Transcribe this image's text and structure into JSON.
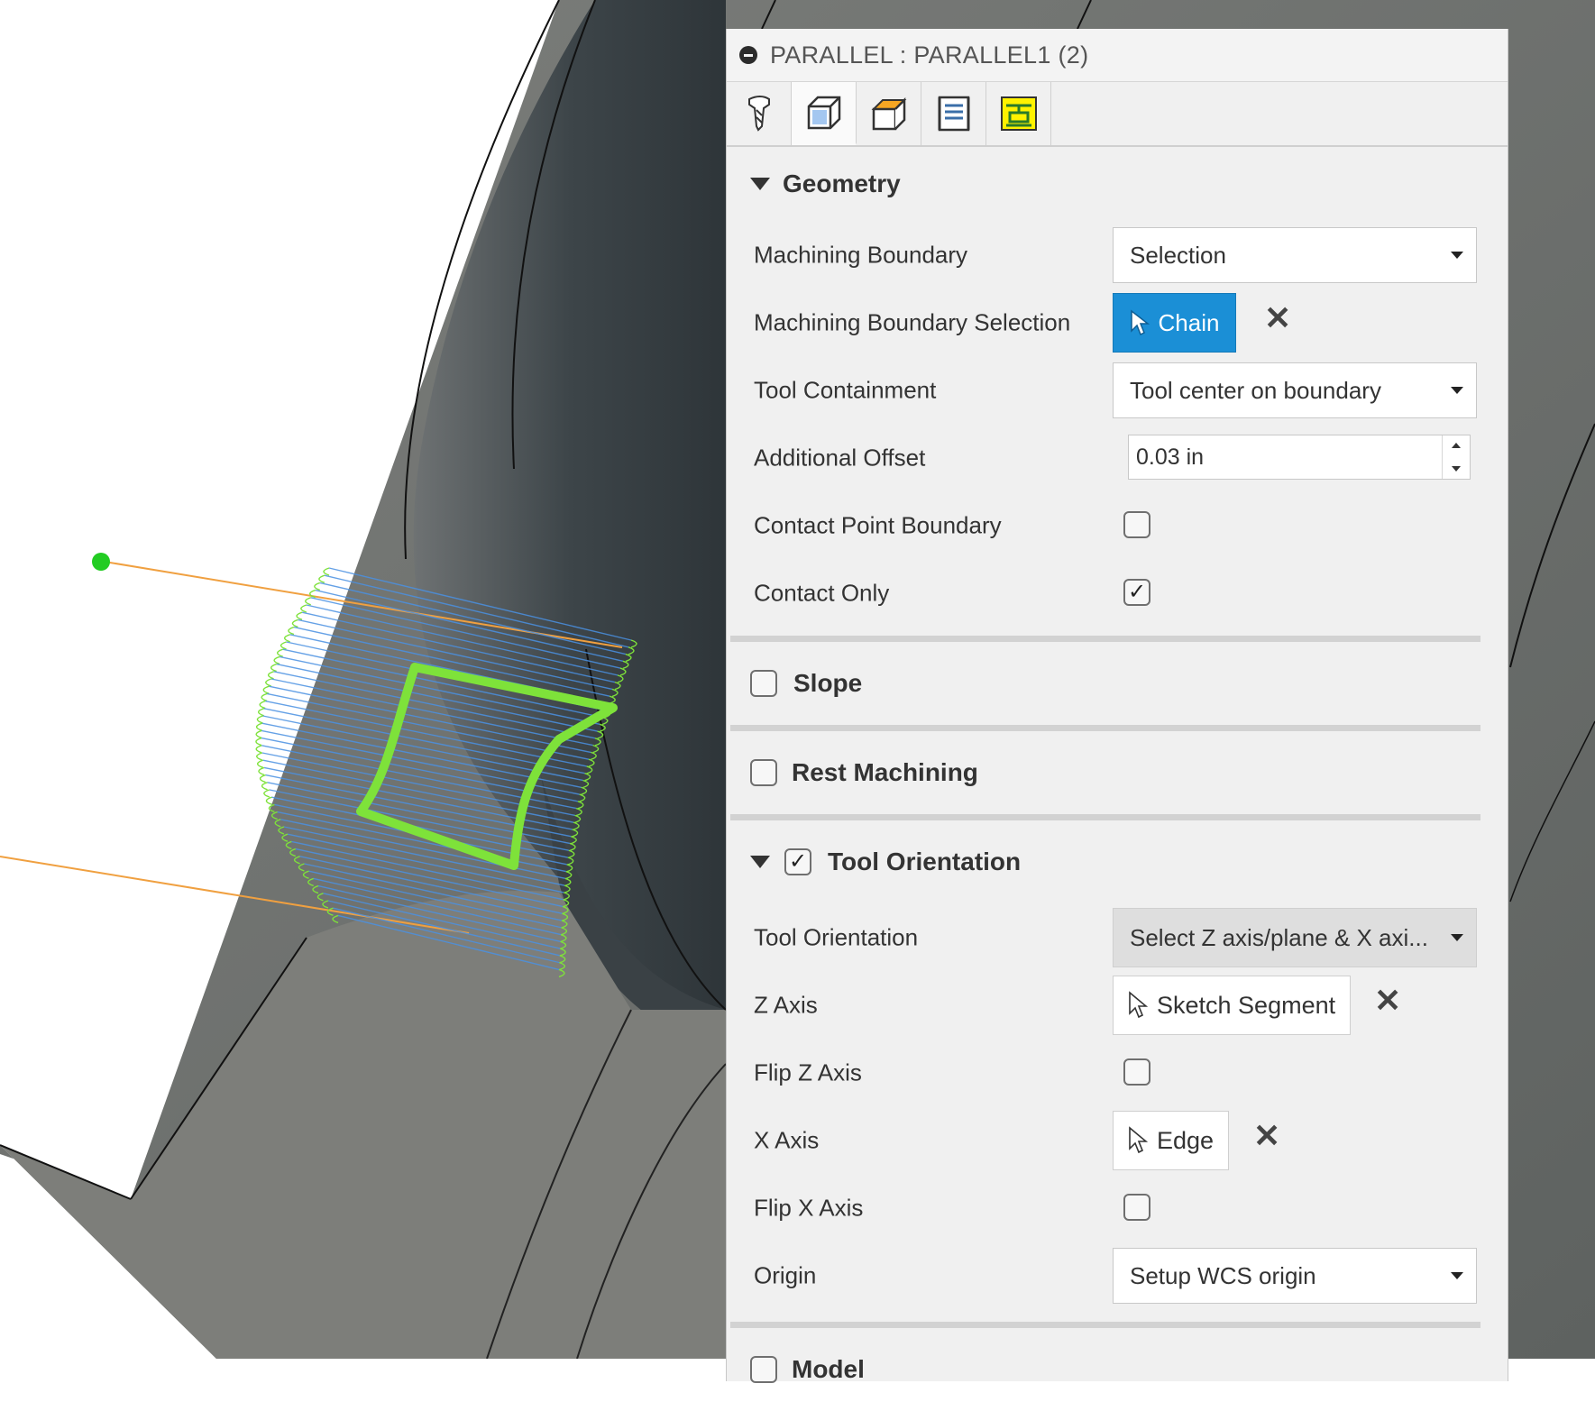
{
  "panel": {
    "title": "PARALLEL : PARALLEL1 (2)",
    "tabs": [
      {
        "name": "tool-tab-icon",
        "active": false
      },
      {
        "name": "geometry-tab-icon",
        "active": true
      },
      {
        "name": "heights-tab-icon",
        "active": false
      },
      {
        "name": "passes-tab-icon",
        "active": false
      },
      {
        "name": "linking-tab-icon",
        "active": false
      }
    ]
  },
  "geometry": {
    "title": "Geometry",
    "machining_boundary": {
      "label": "Machining Boundary",
      "value": "Selection"
    },
    "boundary_selection": {
      "label": "Machining Boundary Selection",
      "button": "Chain",
      "clear": "✕"
    },
    "tool_containment": {
      "label": "Tool Containment",
      "value": "Tool center on boundary"
    },
    "additional_offset": {
      "label": "Additional Offset",
      "value": "0.03 in"
    },
    "contact_point_boundary": {
      "label": "Contact Point Boundary",
      "checked": false
    },
    "contact_only": {
      "label": "Contact Only",
      "checked": true
    }
  },
  "slope": {
    "title": "Slope",
    "checked": false
  },
  "rest_machining": {
    "title": "Rest Machining",
    "checked": false
  },
  "tool_orientation": {
    "title": "Tool Orientation",
    "checked": true,
    "orientation": {
      "label": "Tool Orientation",
      "value": "Select Z axis/plane & X axi..."
    },
    "z_axis": {
      "label": "Z Axis",
      "button": "Sketch Segment",
      "clear": "✕"
    },
    "flip_z": {
      "label": "Flip Z Axis",
      "checked": false
    },
    "x_axis": {
      "label": "X Axis",
      "button": "Edge",
      "clear": "✕"
    },
    "flip_x": {
      "label": "Flip X Axis",
      "checked": false
    },
    "origin": {
      "label": "Origin",
      "value": "Setup WCS origin"
    }
  },
  "model": {
    "title": "Model",
    "checked": false
  },
  "colors": {
    "accent": "#1b8fd6",
    "panel_bg": "#f0f0f0",
    "toolpath_green": "#7ee23a",
    "toolpath_blue": "#4a90e2",
    "lead_orange": "#f0a040"
  },
  "check_glyph": "✓"
}
